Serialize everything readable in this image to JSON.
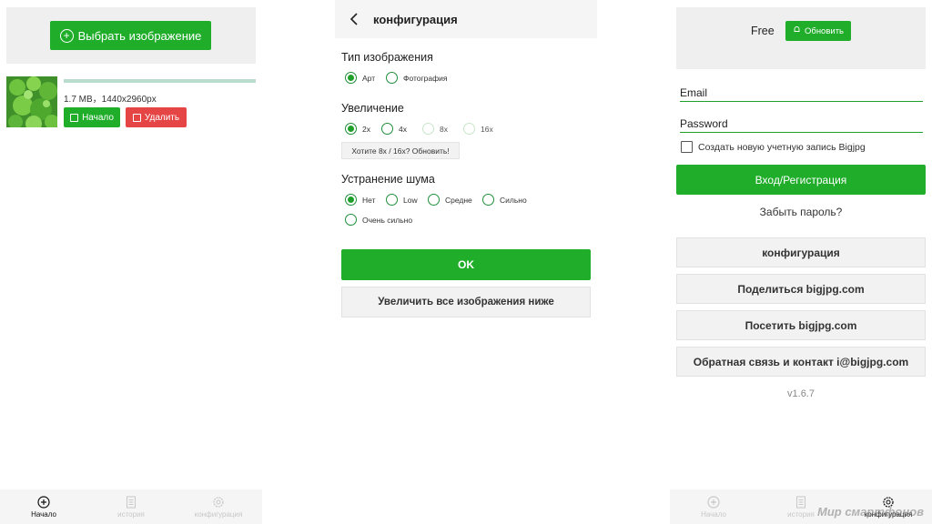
{
  "upload_panel": {
    "select_image_label": "Выбрать изображение",
    "file": {
      "info": "1.7 MB，1440x2960px",
      "progress_percent": 100,
      "start_label": "Начало",
      "delete_label": "Удалить"
    }
  },
  "tabbar": {
    "tabs": [
      {
        "label": "Начало",
        "icon": "plus-circle-icon"
      },
      {
        "label": "история",
        "icon": "document-icon"
      },
      {
        "label": "конфигурация",
        "icon": "gear-icon"
      }
    ]
  },
  "config_panel": {
    "title": "конфигурация",
    "image_type": {
      "title": "Тип изображения",
      "options": [
        "Арт",
        "Фотография"
      ],
      "selected": "Арт"
    },
    "scale": {
      "title": "Увеличение",
      "options": [
        "2x",
        "4x",
        "8x",
        "16x"
      ],
      "selected": "2x",
      "upgrade_hint": "Хотите 8x / 16x? Обновить!"
    },
    "noise": {
      "title": "Устранение шума",
      "options": [
        "Нет",
        "Low",
        "Средне",
        "Сильно",
        "Очень сильно"
      ],
      "selected": "Нет"
    },
    "ok_label": "OK",
    "upscale_all_label": "Увеличить все изображения ниже"
  },
  "account_panel": {
    "plan": "Free",
    "upgrade_label": "Обновить",
    "email_placeholder": "Email",
    "password_placeholder": "Password",
    "create_account_label": "Создать новую учетную запись Bigjpg",
    "login_label": "Вход/Регистрация",
    "forgot_label": "Забыть пароль?",
    "menu": [
      "конфигурация",
      "Поделиться bigjpg.com",
      "Посетить bigjpg.com",
      "Обратная связь и контакт i@bigjpg.com"
    ],
    "version": "v1.6.7"
  },
  "watermark": "Мир смартфонов",
  "colors": {
    "primary_green": "#1fad2a",
    "delete_red": "#e64545",
    "background_gray": "#efefef"
  }
}
